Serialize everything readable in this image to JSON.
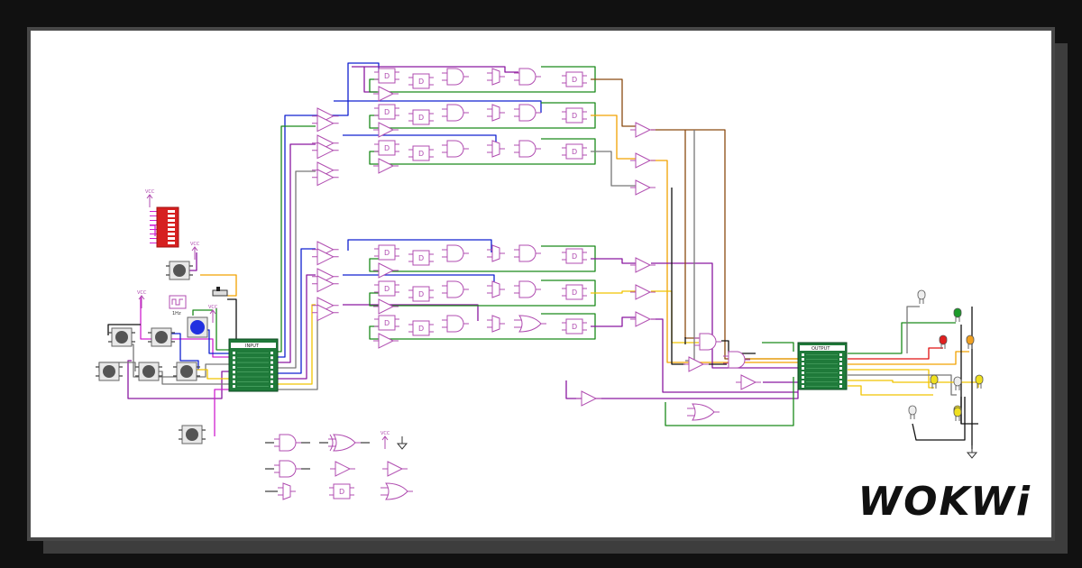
{
  "brand": {
    "logo_text": "WOKWi"
  },
  "labels": {
    "vcc": "VCC",
    "input_header": "INPUT",
    "output_header": "OUTPUT",
    "dff_symbol": "D",
    "clock_label": "1Hz"
  },
  "colors": {
    "frame_background": "#111111",
    "card_background": "#ffffff",
    "gate_outline": "#b04cb0",
    "wire_blue": "#1020d0",
    "wire_green": "#1a8a1a",
    "wire_purple": "#8a18a0",
    "wire_yellow": "#f0c400",
    "wire_orange": "#f2a200",
    "wire_brown": "#8a4a10",
    "wire_gray": "#777777",
    "wire_black": "#111111",
    "wire_red": "#e01010",
    "wire_magenta": "#d020d0",
    "board_green": "#1f7a3a",
    "dip_red": "#d62020",
    "button_blue": "#2030e0"
  },
  "components": {
    "dip_switch_count": 1,
    "pushbutton_count": 8,
    "blue_button_count": 1,
    "slide_switch_count": 1,
    "clock_count": 1,
    "led_colors": [
      "white",
      "green",
      "red",
      "orange",
      "yellow",
      "yellow",
      "yellow",
      "white",
      "white",
      "yellow"
    ],
    "input_board_pins": 8,
    "output_board_pins": 8
  },
  "legend_icons": [
    "and-gate-icon",
    "xor-gate-icon",
    "vcc-symbol-icon",
    "ground-symbol-icon",
    "and-gate-icon",
    "buffer-icon",
    "buffer-icon",
    "mux-icon",
    "d-flipflop-icon",
    "or-gate-icon"
  ]
}
